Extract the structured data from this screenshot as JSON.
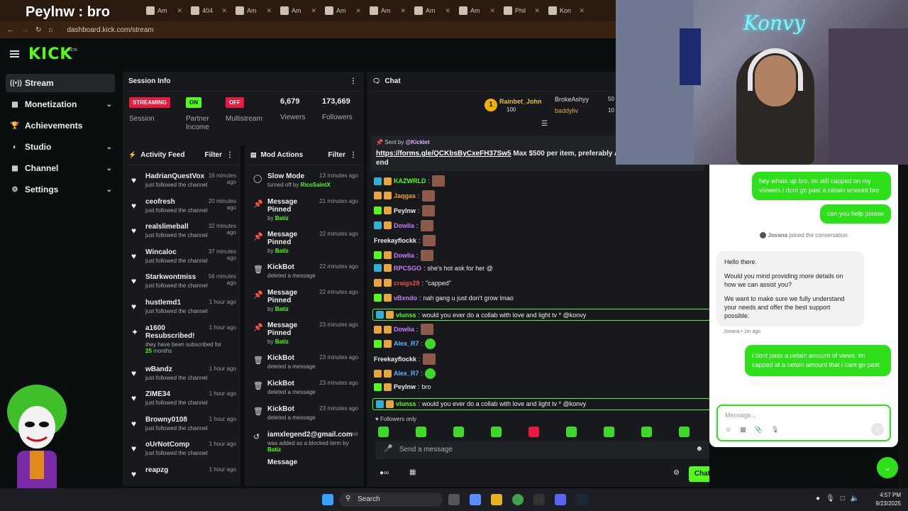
{
  "browser": {
    "first_tab_title": "Peylnw : bro",
    "tabs": [
      "Am",
      "404",
      "Am",
      "Am",
      "Am",
      "Am",
      "Am",
      "Am",
      "Phil",
      "Kon"
    ],
    "url": "dashboard.kick.com/stream"
  },
  "header": {
    "logo": "KICK",
    "beta": "BETA"
  },
  "sidebar": {
    "items": [
      {
        "label": "Stream",
        "icon": "stream-icon"
      },
      {
        "label": "Monetization",
        "icon": "money-icon"
      },
      {
        "label": "Achievements",
        "icon": "trophy-icon"
      },
      {
        "label": "Studio",
        "icon": "studio-icon"
      },
      {
        "label": "Channel",
        "icon": "channel-icon"
      },
      {
        "label": "Settings",
        "icon": "gear-icon"
      }
    ]
  },
  "session": {
    "title": "Session Info",
    "status_badge": "STREAMING",
    "status_label": "Session",
    "partner_badge": "ON",
    "partner_label": "Partner Income",
    "multi_badge": "OFF",
    "multi_label": "Multistream",
    "viewers": "6,679",
    "viewers_label": "Viewers",
    "followers": "173,669",
    "followers_label": "Followers"
  },
  "activity": {
    "title": "Activity Feed",
    "filter": "Filter",
    "items": [
      {
        "name": "HadrianQuestVox",
        "time": "16 minutes ago",
        "text": "just followed the channel"
      },
      {
        "name": "ceofresh",
        "time": "20 minutes ago",
        "text": "just followed the channel"
      },
      {
        "name": "realslimeball",
        "time": "32 minutes ago",
        "text": "just followed the channel"
      },
      {
        "name": "Wincaloc",
        "time": "37 minutes ago",
        "text": "just followed the channel"
      },
      {
        "name": "Starkwontmiss",
        "time": "56 minutes ago",
        "text": "just followed the channel"
      },
      {
        "name": "hustlemd1",
        "time": "1 hour ago",
        "text": "just followed the channel"
      }
    ],
    "resub": {
      "name": "a1600",
      "title": "Resubscribed!",
      "time": "1 hour ago",
      "text": "they have been subscribed for",
      "months": "25",
      "months_label": "months"
    },
    "items2": [
      {
        "name": "wBandz",
        "time": "1 hour ago",
        "text": "just followed the channel"
      },
      {
        "name": "ZIME34",
        "time": "1 hour ago",
        "text": "just followed the channel"
      },
      {
        "name": "Browny0108",
        "time": "1 hour ago",
        "text": "just followed the channel"
      },
      {
        "name": "oUrNotComp",
        "time": "1 hour ago",
        "text": "just followed the channel"
      },
      {
        "name": "reapzg",
        "time": "1 hour ago",
        "text": ""
      }
    ]
  },
  "mods": {
    "title": "Mod Actions",
    "filter": "Filter",
    "items": [
      {
        "icon": "slow-icon",
        "title": "Slow Mode",
        "time": "13 minutes ago",
        "sub": "turned off by",
        "by": "RicoSaintX"
      },
      {
        "icon": "pin-icon",
        "title": "Message Pinned",
        "time": "21 minutes ago",
        "sub": "by",
        "by": "Batiz"
      },
      {
        "icon": "pin-icon",
        "title": "Message Pinned",
        "time": "22 minutes ago",
        "sub": "by",
        "by": "Batiz"
      },
      {
        "icon": "trash-icon",
        "title": "KickBot",
        "time": "22 minutes ago",
        "sub": "deleted a message",
        "by": ""
      },
      {
        "icon": "pin-icon",
        "title": "Message Pinned",
        "time": "22 minutes ago",
        "sub": "by",
        "by": "Batiz"
      },
      {
        "icon": "pin-icon",
        "title": "Message Pinned",
        "time": "23 minutes ago",
        "sub": "by",
        "by": "Batiz"
      },
      {
        "icon": "trash-icon",
        "title": "KickBot",
        "time": "23 minutes ago",
        "sub": "deleted a message",
        "by": ""
      },
      {
        "icon": "trash-icon",
        "title": "KickBot",
        "time": "23 minutes ago",
        "sub": "deleted a message",
        "by": ""
      },
      {
        "icon": "trash-icon",
        "title": "KickBot",
        "time": "23 minutes ago",
        "sub": "deleted a message",
        "by": ""
      },
      {
        "icon": "undo-icon",
        "title": "iamxlegend2@gmail.com",
        "time": "mir",
        "sub": "was added as a blocked term by",
        "by": "Batiz"
      },
      {
        "icon": "",
        "title": "Message",
        "time": "",
        "sub": "",
        "by": ""
      }
    ]
  },
  "chat": {
    "title": "Chat",
    "top": [
      {
        "name": "Rainbet_John",
        "count": "100"
      },
      {
        "name": "BrokeAshyy",
        "count": "50"
      },
      {
        "name": "baddyliv",
        "count": "10"
      }
    ],
    "pin_sent_by": "Sent by",
    "pin_author": "@Kicklet",
    "pin_link": "https://forms.gle/QCKbsByCxeFH37Sw5",
    "pin_text": " Max $500 per item, preferably Am",
    "pin_text2": "end",
    "messages": [
      {
        "user": "KAZWRLD",
        "color": "#53fc18",
        "text": "",
        "emote": "brown",
        "hl": false
      },
      {
        "user": "Jaqgas",
        "color": "#e7a53a",
        "text": "",
        "emote": "brown",
        "hl": false
      },
      {
        "user": "Peylnw",
        "color": "#eeeeee",
        "text": "",
        "emote": "brown",
        "hl": false
      },
      {
        "user": "Dowlia",
        "color": "#c77dff",
        "text": "",
        "emote": "brown",
        "hl": false
      },
      {
        "user": "Freekayflockk",
        "color": "#eeeeee",
        "text": "",
        "emote": "brown",
        "hl": false
      },
      {
        "user": "Dowlia",
        "color": "#c77dff",
        "text": "",
        "emote": "brown",
        "hl": false
      },
      {
        "user": "RPCSGO",
        "color": "#c77dff",
        "text": "she's hot ask for her @",
        "emote": "",
        "hl": false
      },
      {
        "user": "craigs28",
        "color": "#e94f4f",
        "text": "\"capped\"",
        "emote": "",
        "hl": false
      },
      {
        "user": "vBxndo",
        "color": "#c77dff",
        "text": "nah gang u just don't grow lmao",
        "emote": "",
        "hl": false
      },
      {
        "user": "vlunss",
        "color": "#53fc18",
        "text": "would you ever do a collab with love and light tv * @konvy",
        "emote": "",
        "hl": true
      },
      {
        "user": "Dowlia",
        "color": "#c77dff",
        "text": "",
        "emote": "brown",
        "hl": false
      },
      {
        "user": "Alex_R7",
        "color": "#5bb4ff",
        "text": "",
        "emote": "green",
        "hl": false
      },
      {
        "user": "Freekayflockk",
        "color": "#eeeeee",
        "text": "",
        "emote": "brown",
        "hl": false
      },
      {
        "user": "Alex_R7",
        "color": "#5bb4ff",
        "text": "",
        "emote": "green",
        "hl": false
      },
      {
        "user": "Peylnw",
        "color": "#eeeeee",
        "text": "bro",
        "emote": "",
        "hl": false
      },
      {
        "user": "vlunss",
        "color": "#53fc18",
        "text": "would you ever do a collab with love and light tv * @konvy",
        "emote": "",
        "hl": true
      }
    ],
    "followers_only": "Followers only",
    "input_placeholder": "Send a message",
    "send_button": "Chat"
  },
  "webcam": {
    "neon": "Konvy"
  },
  "support": {
    "msg1": "hey whats up bro, im still capped on my viewers i dont go past a cetain amount bro",
    "msg2": "can you help please",
    "joined_name": "Jovana",
    "joined_text": "joined the conversation",
    "reply_1": "Hello there.",
    "reply_2": "Would you mind providing more details on how we can assist you?",
    "reply_3": "We want to make sure we fully understand your needs and offer the best support possible.",
    "reply_meta": "Jovana • 1m ago",
    "msg3": "i dont pass a cetain amount of views. im capped at a cetain amount that i cant go past",
    "input_placeholder": "Message..."
  },
  "taskbar": {
    "search": "Search",
    "time": "4:57 PM",
    "date": "9/23/2025"
  }
}
